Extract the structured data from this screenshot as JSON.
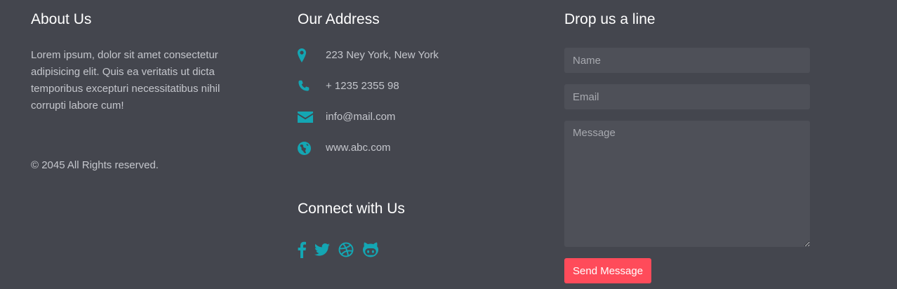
{
  "about": {
    "title": "About Us",
    "text": "Lorem ipsum, dolor sit amet consectetur adipisicing elit. Quis ea veritatis ut dicta temporibus excepturi necessitatibus nihil corrupti labore cum!",
    "copyright": "© 2045 All Rights reserved."
  },
  "address": {
    "title": "Our Address",
    "items": [
      {
        "icon": "map-marker-icon",
        "text": "223 Ney York, New York"
      },
      {
        "icon": "phone-icon",
        "text": "+ 1235 2355 98"
      },
      {
        "icon": "envelope-icon",
        "text": "info@mail.com"
      },
      {
        "icon": "globe-icon",
        "text": "www.abc.com"
      }
    ]
  },
  "connect": {
    "title": "Connect with Us",
    "links": [
      {
        "icon": "facebook-icon"
      },
      {
        "icon": "twitter-icon"
      },
      {
        "icon": "dribbble-icon"
      },
      {
        "icon": "github-icon"
      }
    ]
  },
  "contact": {
    "title": "Drop us a line",
    "name_placeholder": "Name",
    "email_placeholder": "Email",
    "message_placeholder": "Message",
    "send_label": "Send Message"
  },
  "colors": {
    "background": "#44464e",
    "field": "#4e5058",
    "accent": "#14a6b3",
    "button": "#ff4b5a",
    "heading": "#ffffff",
    "text": "#c4c6cc"
  }
}
